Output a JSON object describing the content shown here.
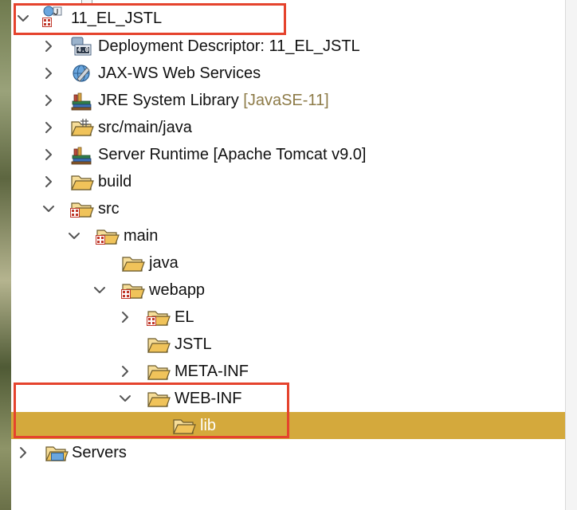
{
  "project_explorer": {
    "project": {
      "label": "11_EL_JSTL"
    },
    "deployment_descriptor": {
      "label": "Deployment Descriptor: 11_EL_JSTL"
    },
    "jaxws": {
      "label": "JAX-WS Web Services"
    },
    "jre": {
      "label": "JRE System Library",
      "decoration": "[JavaSE-11]"
    },
    "src_main_java": {
      "label": "src/main/java"
    },
    "server_runtime": {
      "label": "Server Runtime [Apache Tomcat v9.0]"
    },
    "build": {
      "label": "build"
    },
    "src": {
      "label": "src"
    },
    "main": {
      "label": "main"
    },
    "java": {
      "label": "java"
    },
    "webapp": {
      "label": "webapp"
    },
    "el": {
      "label": "EL"
    },
    "jstl": {
      "label": "JSTL"
    },
    "meta_inf": {
      "label": "META-INF"
    },
    "web_inf": {
      "label": "WEB-INF"
    },
    "lib": {
      "label": "lib"
    },
    "servers": {
      "label": "Servers"
    },
    "dd_badge": "4.0"
  },
  "colors": {
    "selection": "#d4a93c",
    "annotation": "#e5432d",
    "folder": "#f0c35a",
    "decoration_text": "#8d7b48"
  }
}
